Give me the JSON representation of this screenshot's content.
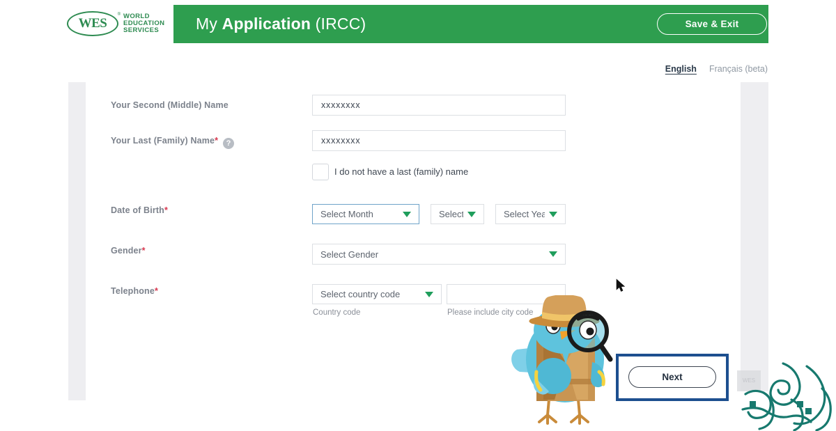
{
  "brand": {
    "logo_mark": "WES",
    "logo_registered": "®",
    "logo_words": [
      "WORLD",
      "EDUCATION",
      "SERVICES"
    ],
    "green": "#2e9e4f",
    "navy_highlight": "#1d4f8f"
  },
  "header": {
    "title_prefix": "My ",
    "title_bold": "Application",
    "title_suffix": " (IRCC)",
    "save_exit_label": "Save & Exit"
  },
  "language": {
    "active": "English",
    "alternate": "Français (beta)"
  },
  "form": {
    "fields": [
      {
        "label": "Your Second (Middle) Name",
        "required": false,
        "help": false,
        "value": "xxxxxxxx"
      },
      {
        "label": "Your Last (Family) Name",
        "required": true,
        "help": true,
        "help_glyph": "?",
        "value": "xxxxxxxx"
      }
    ],
    "checkbox": {
      "label": "I do not have a last (family) name",
      "checked": false
    },
    "dob": {
      "label": "Date of Birth",
      "required": true,
      "month": "Select Month",
      "day": "Select Da",
      "day_full": "Select Date",
      "year": "Select Year",
      "focused": "month"
    },
    "gender": {
      "label": "Gender",
      "required": true,
      "value": "Select Gender"
    },
    "telephone": {
      "label": "Telephone",
      "required": true,
      "country_code_value": "Select country code",
      "country_code_helper": "Country code",
      "number_value": "",
      "number_helper": "Please include city code"
    },
    "required_marker": "*"
  },
  "footer": {
    "next_label": "Next",
    "ghost_label": "WES"
  },
  "icons": {
    "caret": "chevron-down-icon",
    "cursor": "mouse-cursor",
    "mascot": "detective-bird-mascot",
    "watermark": "calligraphy-watermark"
  }
}
